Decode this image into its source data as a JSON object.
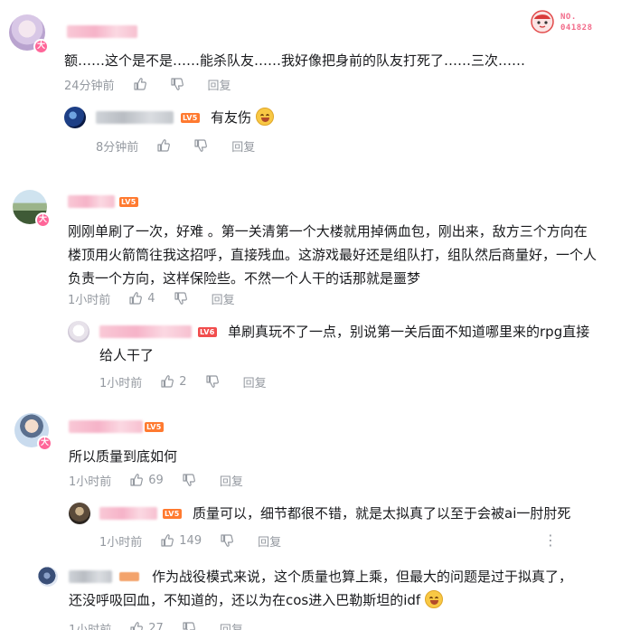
{
  "fan_badge": {
    "label": "NO.",
    "number": "041828"
  },
  "icons": {
    "like": "thumbs-up-icon",
    "dislike": "thumbs-down-icon",
    "more": "more-vertical-icon",
    "big_member": "大"
  },
  "comments": [
    {
      "content": "额……这个是不是……能杀队友……我好像把身前的队友打死了……三次……",
      "time": "24分钟前",
      "likes": "",
      "reply_label": "回复",
      "replies": [
        {
          "level": "LV5",
          "content": "有友伤",
          "time": "8分钟前",
          "likes": "",
          "reply_label": "回复"
        }
      ]
    },
    {
      "level": "LV5",
      "content_lines": [
        "刚刚单刷了一次，好难 。第一关清第一个大楼就用掉俩血包，刚出来，敌方三个方向在",
        "楼顶用火箭筒往我这招呼，直接残血。这游戏最好还是组队打，组队然后商量好，一个人",
        "负责一个方向，这样保险些。不然一个人干的话那就是噩梦"
      ],
      "time": "1小时前",
      "likes": "4",
      "reply_label": "回复",
      "replies": [
        {
          "level": "LV6",
          "content_lines": [
            "单刷真玩不了一点，别说第一关后面不知道哪里来的rpg直接",
            "给人干了"
          ],
          "time": "1小时前",
          "likes": "2",
          "reply_label": "回复"
        }
      ]
    },
    {
      "level": "LV5",
      "content": "所以质量到底如何",
      "time": "1小时前",
      "likes": "69",
      "reply_label": "回复",
      "replies": [
        {
          "level": "LV5",
          "content": "质量可以，细节都很不错，就是太拟真了以至于会被ai一肘肘死",
          "time": "1小时前",
          "likes": "149",
          "reply_label": "回复"
        },
        {
          "content_lines": [
            "作为战役模式来说，这个质量也算上乘，但最大的问题是过于拟真了，",
            "还没呼吸回血，不知道的，还以为在cos进入巴勒斯坦的idf"
          ],
          "time": "1小时前",
          "likes": "27",
          "reply_label": "回复"
        }
      ]
    }
  ]
}
